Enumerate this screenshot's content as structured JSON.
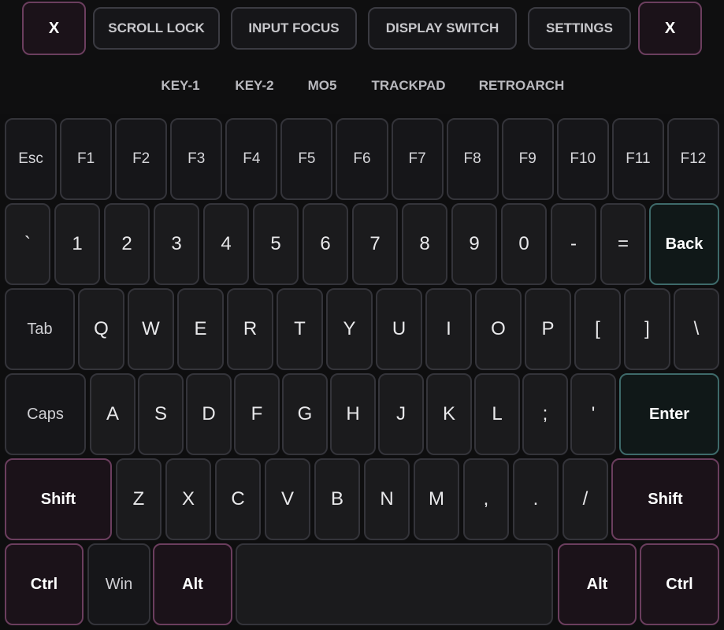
{
  "header": {
    "buttons": [
      {
        "id": "close-left",
        "label": "X"
      },
      {
        "id": "scroll-lock",
        "label": "SCROLL LOCK"
      },
      {
        "id": "input-focus",
        "label": "INPUT FOCUS"
      },
      {
        "id": "display-switch",
        "label": "DISPLAY SWITCH"
      },
      {
        "id": "settings",
        "label": "SETTINGS"
      },
      {
        "id": "close-right",
        "label": "X"
      }
    ],
    "tabs": [
      "KEY-1",
      "KEY-2",
      "MO5",
      "TRACKPAD",
      "RETROARCH"
    ]
  },
  "keyboard": {
    "rows": [
      [
        "Esc",
        "F1",
        "F2",
        "F3",
        "F4",
        "F5",
        "F6",
        "F7",
        "F8",
        "F9",
        "F10",
        "F11",
        "F12"
      ],
      [
        "`",
        "1",
        "2",
        "3",
        "4",
        "5",
        "6",
        "7",
        "8",
        "9",
        "0",
        "-",
        "=",
        "Back"
      ],
      [
        "Tab",
        "Q",
        "W",
        "E",
        "R",
        "T",
        "Y",
        "U",
        "I",
        "O",
        "P",
        "[",
        "]",
        "\\"
      ],
      [
        "Caps",
        "A",
        "S",
        "D",
        "F",
        "G",
        "H",
        "J",
        "K",
        "L",
        ";",
        "'",
        "Enter"
      ],
      [
        "Shift",
        "Z",
        "X",
        "C",
        "V",
        "B",
        "N",
        "M",
        ",",
        ".",
        "/",
        "Shift"
      ],
      [
        "Ctrl",
        "Win",
        "Alt",
        "",
        "Alt",
        "Ctrl"
      ]
    ]
  },
  "colors": {
    "background": "#0e0e0f",
    "key_fill": "#1b1b1d",
    "key_border": "#34343a",
    "modifier_accent": "#6b3e5e",
    "action_accent": "#3e6a6a"
  }
}
